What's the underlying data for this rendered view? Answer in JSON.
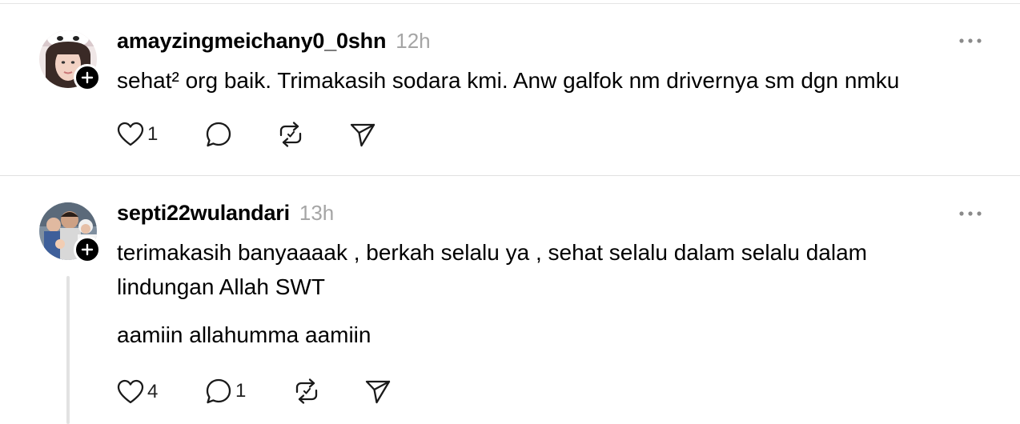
{
  "posts": [
    {
      "username": "amayzingmeichany0_0shn",
      "time": "12h",
      "text_lines": [
        "sehat² org baik. Trimakasih sodara kmi. Anw galfok nm drivernya sm dgn nmku"
      ],
      "extra_text": "",
      "likes": "1",
      "replies": "",
      "icons": {
        "like": "heart-icon",
        "reply": "comment-icon",
        "repost": "repost-icon",
        "share": "share-icon",
        "more": "more-dots-icon"
      }
    },
    {
      "username": "septi22wulandari",
      "time": "13h",
      "text_lines": [
        "terimakasih banyaaaak , berkah selalu ya , sehat selalu dalam selalu dalam",
        "lindungan Allah SWT"
      ],
      "extra_text": "aamiin allahumma aamiin",
      "likes": "4",
      "replies": "1",
      "icons": {
        "like": "heart-icon",
        "reply": "comment-icon",
        "repost": "repost-icon",
        "share": "share-icon",
        "more": "more-dots-icon"
      }
    }
  ],
  "colors": {
    "text": "#000000",
    "muted": "#a5a5a5",
    "divider": "#e0e0e0",
    "icon": "#1a1a1a"
  }
}
